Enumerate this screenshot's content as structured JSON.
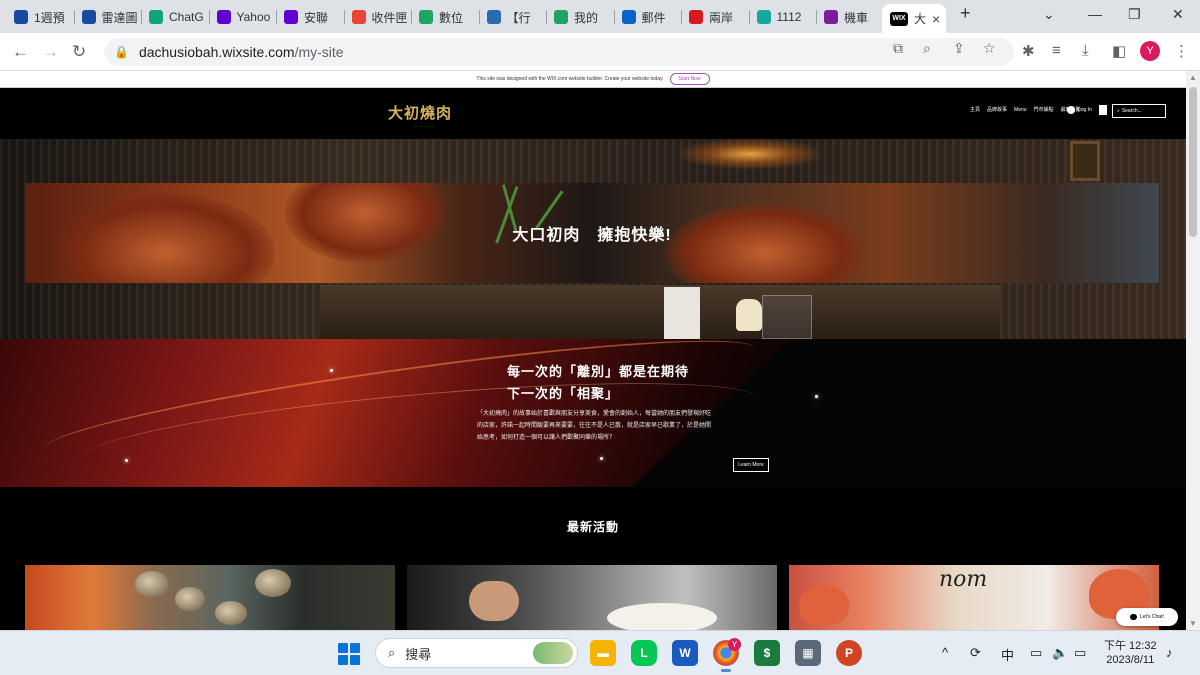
{
  "browser": {
    "tabs": [
      {
        "label": "1週預",
        "icon": "eye-icon",
        "color": "#1a4aa0"
      },
      {
        "label": "雷達圖",
        "icon": "eye-icon",
        "color": "#1a4aa0"
      },
      {
        "label": "ChatG",
        "icon": "openai-icon",
        "color": "#10a37f"
      },
      {
        "label": "Yahoo",
        "icon": "yahoo-icon",
        "color": "#6001d2"
      },
      {
        "label": "安聯",
        "icon": "yahoo-icon",
        "color": "#6001d2"
      },
      {
        "label": "收件匣",
        "icon": "gmail-icon",
        "color": "#ea4335"
      },
      {
        "label": "數位",
        "icon": "drive-icon",
        "color": "#1fa463"
      },
      {
        "label": "【行",
        "icon": "gov-icon",
        "color": "#2a6ab0"
      },
      {
        "label": "我的",
        "icon": "drive-icon",
        "color": "#1fa463"
      },
      {
        "label": "郵件",
        "icon": "outlook-icon",
        "color": "#0a64c8"
      },
      {
        "label": "兩岸",
        "icon": "chinatimes-icon",
        "color": "#d71920"
      },
      {
        "label": "1112",
        "icon": "m-icon",
        "color": "#16a89e"
      },
      {
        "label": "機車",
        "icon": "globe-icon",
        "color": "#7a1ea0"
      }
    ],
    "active_tab": {
      "label": "大",
      "icon": "wix-icon",
      "icon_text": "WIX"
    },
    "new_tab_label": "+",
    "url_host": "dachusiobah.wixsite.com",
    "url_path": "/my-site",
    "profile_initial": "Y"
  },
  "wix_banner": {
    "text": "This site was designed with the WIX.com website builder. Create your website today.",
    "button": "Start Now"
  },
  "site": {
    "logo": "大初燒肉",
    "nav": [
      "主頁",
      "品牌故事",
      "Menu",
      "門市據點",
      "最新活動"
    ],
    "login": "Log In",
    "search_placeholder": "Search..."
  },
  "hero": {
    "banner_title": "大口初肉　擁抱快樂!"
  },
  "story": {
    "heading_line1": "每一次的「離別」都是在期待",
    "heading_line2": "下一次的「相聚」",
    "body": "「大初燒肉」的故事始於喜歡與朋友分享美食，愛會的創始人，每當她的朋友們發現好吃的店家，許諾一起時間飯要再來要要，往往不是人已散，就是店家早已歇業了，於是她開始思考，如何打造一個可以讓人們歡聚同樂的場所？",
    "button": "Learn More"
  },
  "latest": {
    "title": "最新活動"
  },
  "chat": {
    "label": "Let's Chat!"
  },
  "taskbar": {
    "search_label": "搜尋",
    "chrome_badge": "Y",
    "ime": "中",
    "time": "下午 12:32",
    "date": "2023/8/11"
  }
}
